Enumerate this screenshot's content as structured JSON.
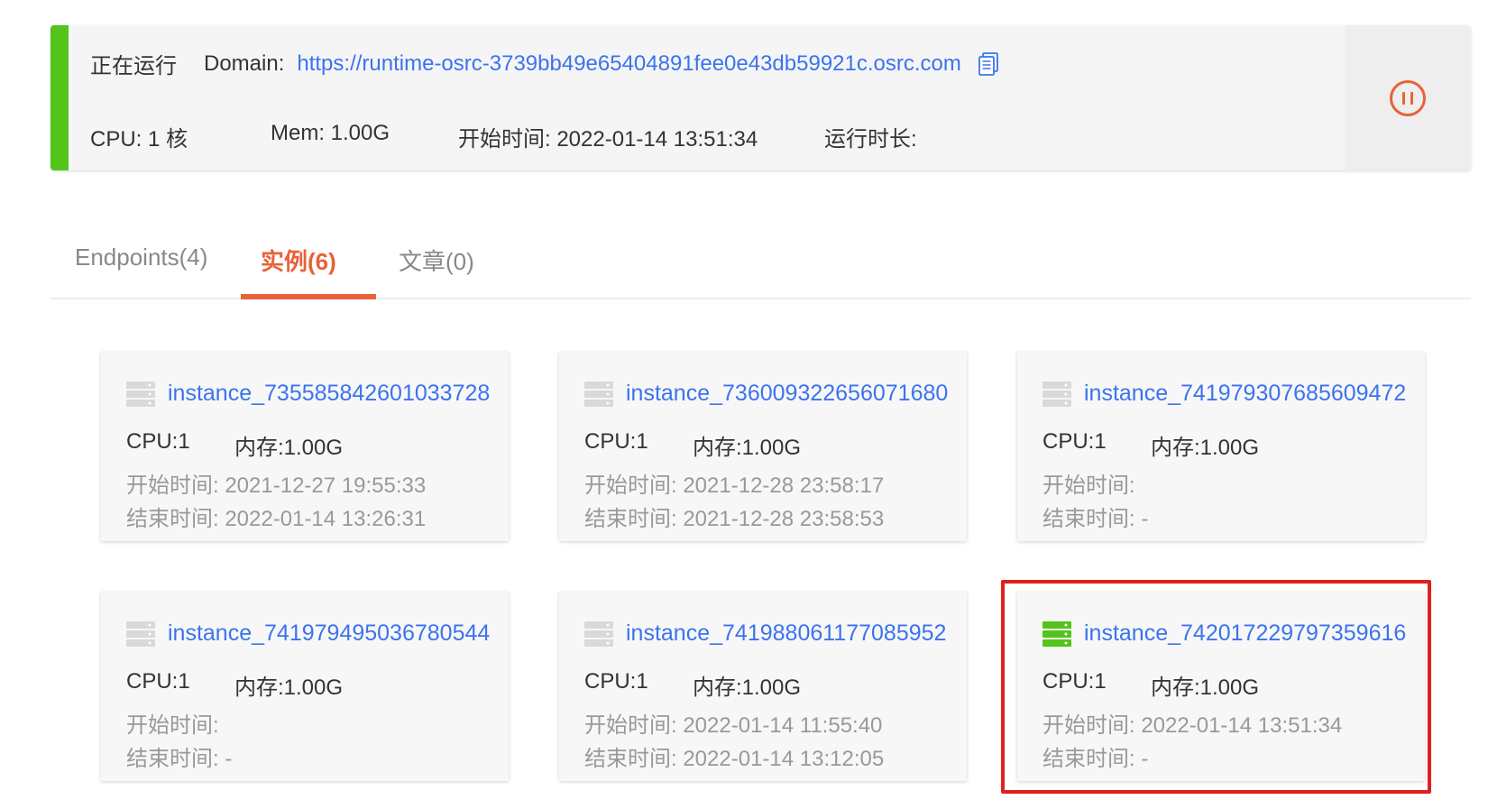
{
  "status": {
    "state": "正在运行",
    "domain_label": "Domain:",
    "domain_url": "https://runtime-osrc-3739bb49e65404891fee0e43db59921c.osrc.com",
    "cpu": "CPU:  1 核",
    "mem": "Mem:  1.00G",
    "start_time": "开始时间:  2022-01-14 13:51:34",
    "runtime": "运行时长:",
    "colors": {
      "running": "#52c41a",
      "accent": "#e8623a",
      "link": "#3b73ef"
    },
    "icons": {
      "copy": "copy-icon",
      "pause": "pause-icon"
    }
  },
  "tabs": [
    {
      "label": "Endpoints(4)",
      "active": false
    },
    {
      "label": "实例(6)",
      "active": true
    },
    {
      "label": "文章(0)",
      "active": false
    }
  ],
  "instances": [
    {
      "name": "instance_735585842601033728",
      "cpu": "CPU:1",
      "mem": "内存:1.00G",
      "start": "开始时间: 2021-12-27 19:55:33",
      "end": "结束时间: 2022-01-14 13:26:31",
      "active": false
    },
    {
      "name": "instance_736009322656071680",
      "cpu": "CPU:1",
      "mem": "内存:1.00G",
      "start": "开始时间: 2021-12-28 23:58:17",
      "end": "结束时间: 2021-12-28 23:58:53",
      "active": false
    },
    {
      "name": "instance_741979307685609472",
      "cpu": "CPU:1",
      "mem": "内存:1.00G",
      "start": "开始时间:",
      "end": "结束时间: -",
      "active": false
    },
    {
      "name": "instance_741979495036780544",
      "cpu": "CPU:1",
      "mem": "内存:1.00G",
      "start": "开始时间:",
      "end": "结束时间: -",
      "active": false
    },
    {
      "name": "instance_741988061177085952",
      "cpu": "CPU:1",
      "mem": "内存:1.00G",
      "start": "开始时间: 2022-01-14 11:55:40",
      "end": "结束时间: 2022-01-14 13:12:05",
      "active": false
    },
    {
      "name": "instance_742017229797359616",
      "cpu": "CPU:1",
      "mem": "内存:1.00G",
      "start": "开始时间: 2022-01-14 13:51:34",
      "end": "结束时间: -",
      "active": true
    }
  ],
  "icon_colors": {
    "server_inactive": "#d9d9d9",
    "server_active": "#52c41a"
  },
  "highlight_color": "#e02020"
}
